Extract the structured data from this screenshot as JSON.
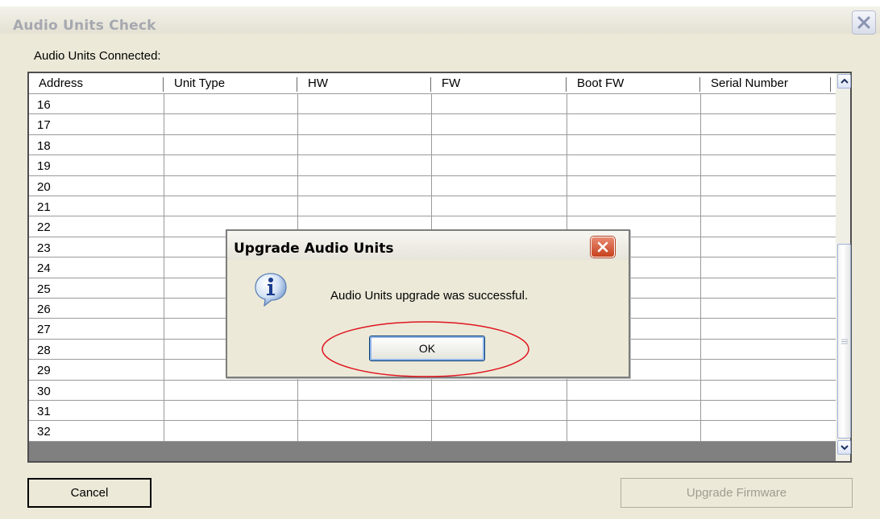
{
  "window": {
    "title": "Audio Units Check",
    "close_icon": "close-icon"
  },
  "connected_label": "Audio Units Connected:",
  "table": {
    "columns": [
      "Address",
      "Unit Type",
      "HW",
      "FW",
      "Boot FW",
      "Serial Number"
    ],
    "rows": [
      {
        "address": "16"
      },
      {
        "address": "17"
      },
      {
        "address": "18"
      },
      {
        "address": "19"
      },
      {
        "address": "20"
      },
      {
        "address": "21"
      },
      {
        "address": "22"
      },
      {
        "address": "23"
      },
      {
        "address": "24"
      },
      {
        "address": "25"
      },
      {
        "address": "26"
      },
      {
        "address": "27"
      },
      {
        "address": "28"
      },
      {
        "address": "29"
      },
      {
        "address": "30"
      },
      {
        "address": "31"
      },
      {
        "address": "32"
      }
    ]
  },
  "buttons": {
    "cancel": "Cancel",
    "upgrade_firmware": "Upgrade Firmware"
  },
  "dialog": {
    "title": "Upgrade Audio Units",
    "message": "Audio Units upgrade was successful.",
    "ok": "OK",
    "icon": "info-icon"
  },
  "colors": {
    "close_button_red": "#c7401d",
    "highlight": "#e0141e",
    "header_text_disabled": "#a6a8b0"
  }
}
